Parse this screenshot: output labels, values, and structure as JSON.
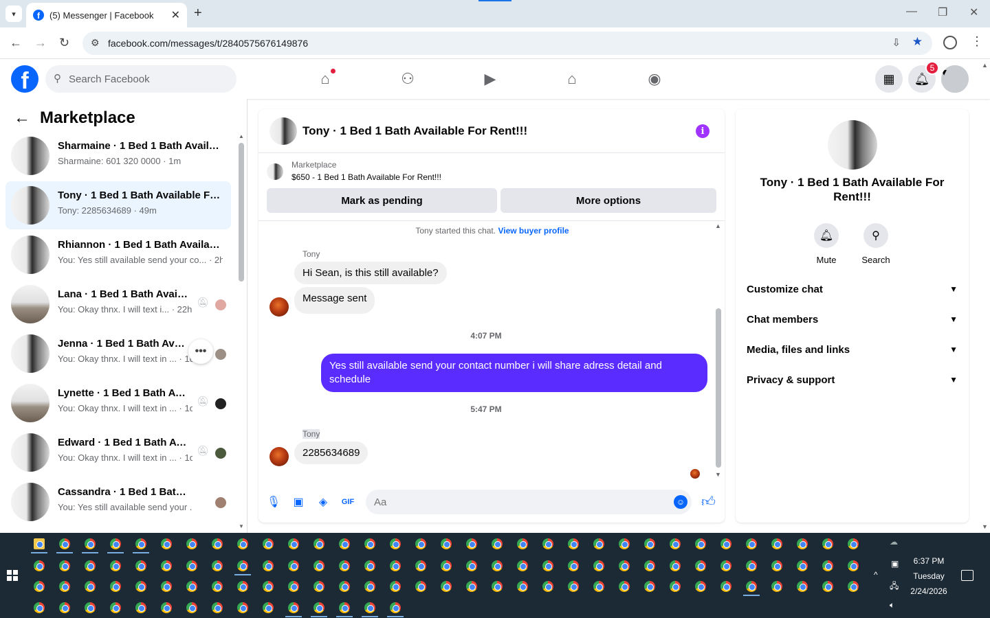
{
  "browser": {
    "tab_title": "(5) Messenger | Facebook",
    "url": "facebook.com/messages/t/2840575676149876"
  },
  "fb": {
    "search_placeholder": "Search Facebook",
    "notification_count": "5"
  },
  "left": {
    "title": "Marketplace",
    "conversations": [
      {
        "name": "Sharmaine · 1 Bed 1 Bath Availab...",
        "sub": "Sharmaine: 601 320 0000 · 1m"
      },
      {
        "name": "Tony · 1 Bed 1 Bath Available For...",
        "sub": "Tony: 2285634689 · 49m"
      },
      {
        "name": "Rhiannon · 1 Bed 1 Bath Availabl...",
        "sub": "You: Yes still available send your co... · 2h"
      },
      {
        "name": "Lana · 1 Bed 1 Bath Availa...",
        "sub": "You: Okay thnx. I will text i... · 22h"
      },
      {
        "name": "Jenna · 1 Bed 1 Bath Availa...",
        "sub": "You: Okay thnx. I will text in ... · 1d"
      },
      {
        "name": "Lynette · 1 Bed 1 Bath Avai...",
        "sub": "You: Okay thnx. I will text in ... · 1d"
      },
      {
        "name": "Edward · 1 Bed 1 Bath Avai...",
        "sub": "You: Okay thnx. I will text in ... · 1d"
      },
      {
        "name": "Cassandra · 1 Bed 1 Bath Avail...",
        "sub": "You: Yes still available send your ... · 4d"
      }
    ]
  },
  "chat": {
    "title": "Tony · 1 Bed 1 Bath Available For Rent!!!",
    "marketplace_label": "Marketplace",
    "listing": "$650 - 1 Bed 1 Bath Available For Rent!!!",
    "mark_pending": "Mark as pending",
    "more_options": "More options",
    "started_text": "Tony started this chat.",
    "view_buyer": "View buyer profile",
    "sender1": "Tony",
    "msg1": "Hi Sean, is this still available?",
    "msg2": "Message sent",
    "time1": "4:07 PM",
    "msg_out": "Yes still available send your contact number i will share adress detail and schedule",
    "time2": "5:47 PM",
    "sender2": "Tony",
    "msg3": "2285634689",
    "composer_placeholder": "Aa"
  },
  "right": {
    "name": "Tony · 1 Bed 1 Bath Available For Rent!!!",
    "mute": "Mute",
    "search": "Search",
    "sections": [
      "Customize chat",
      "Chat members",
      "Media, files and links",
      "Privacy & support"
    ]
  },
  "taskbar": {
    "time": "6:37 PM",
    "day": "Tuesday",
    "date": "2/24/2026"
  }
}
